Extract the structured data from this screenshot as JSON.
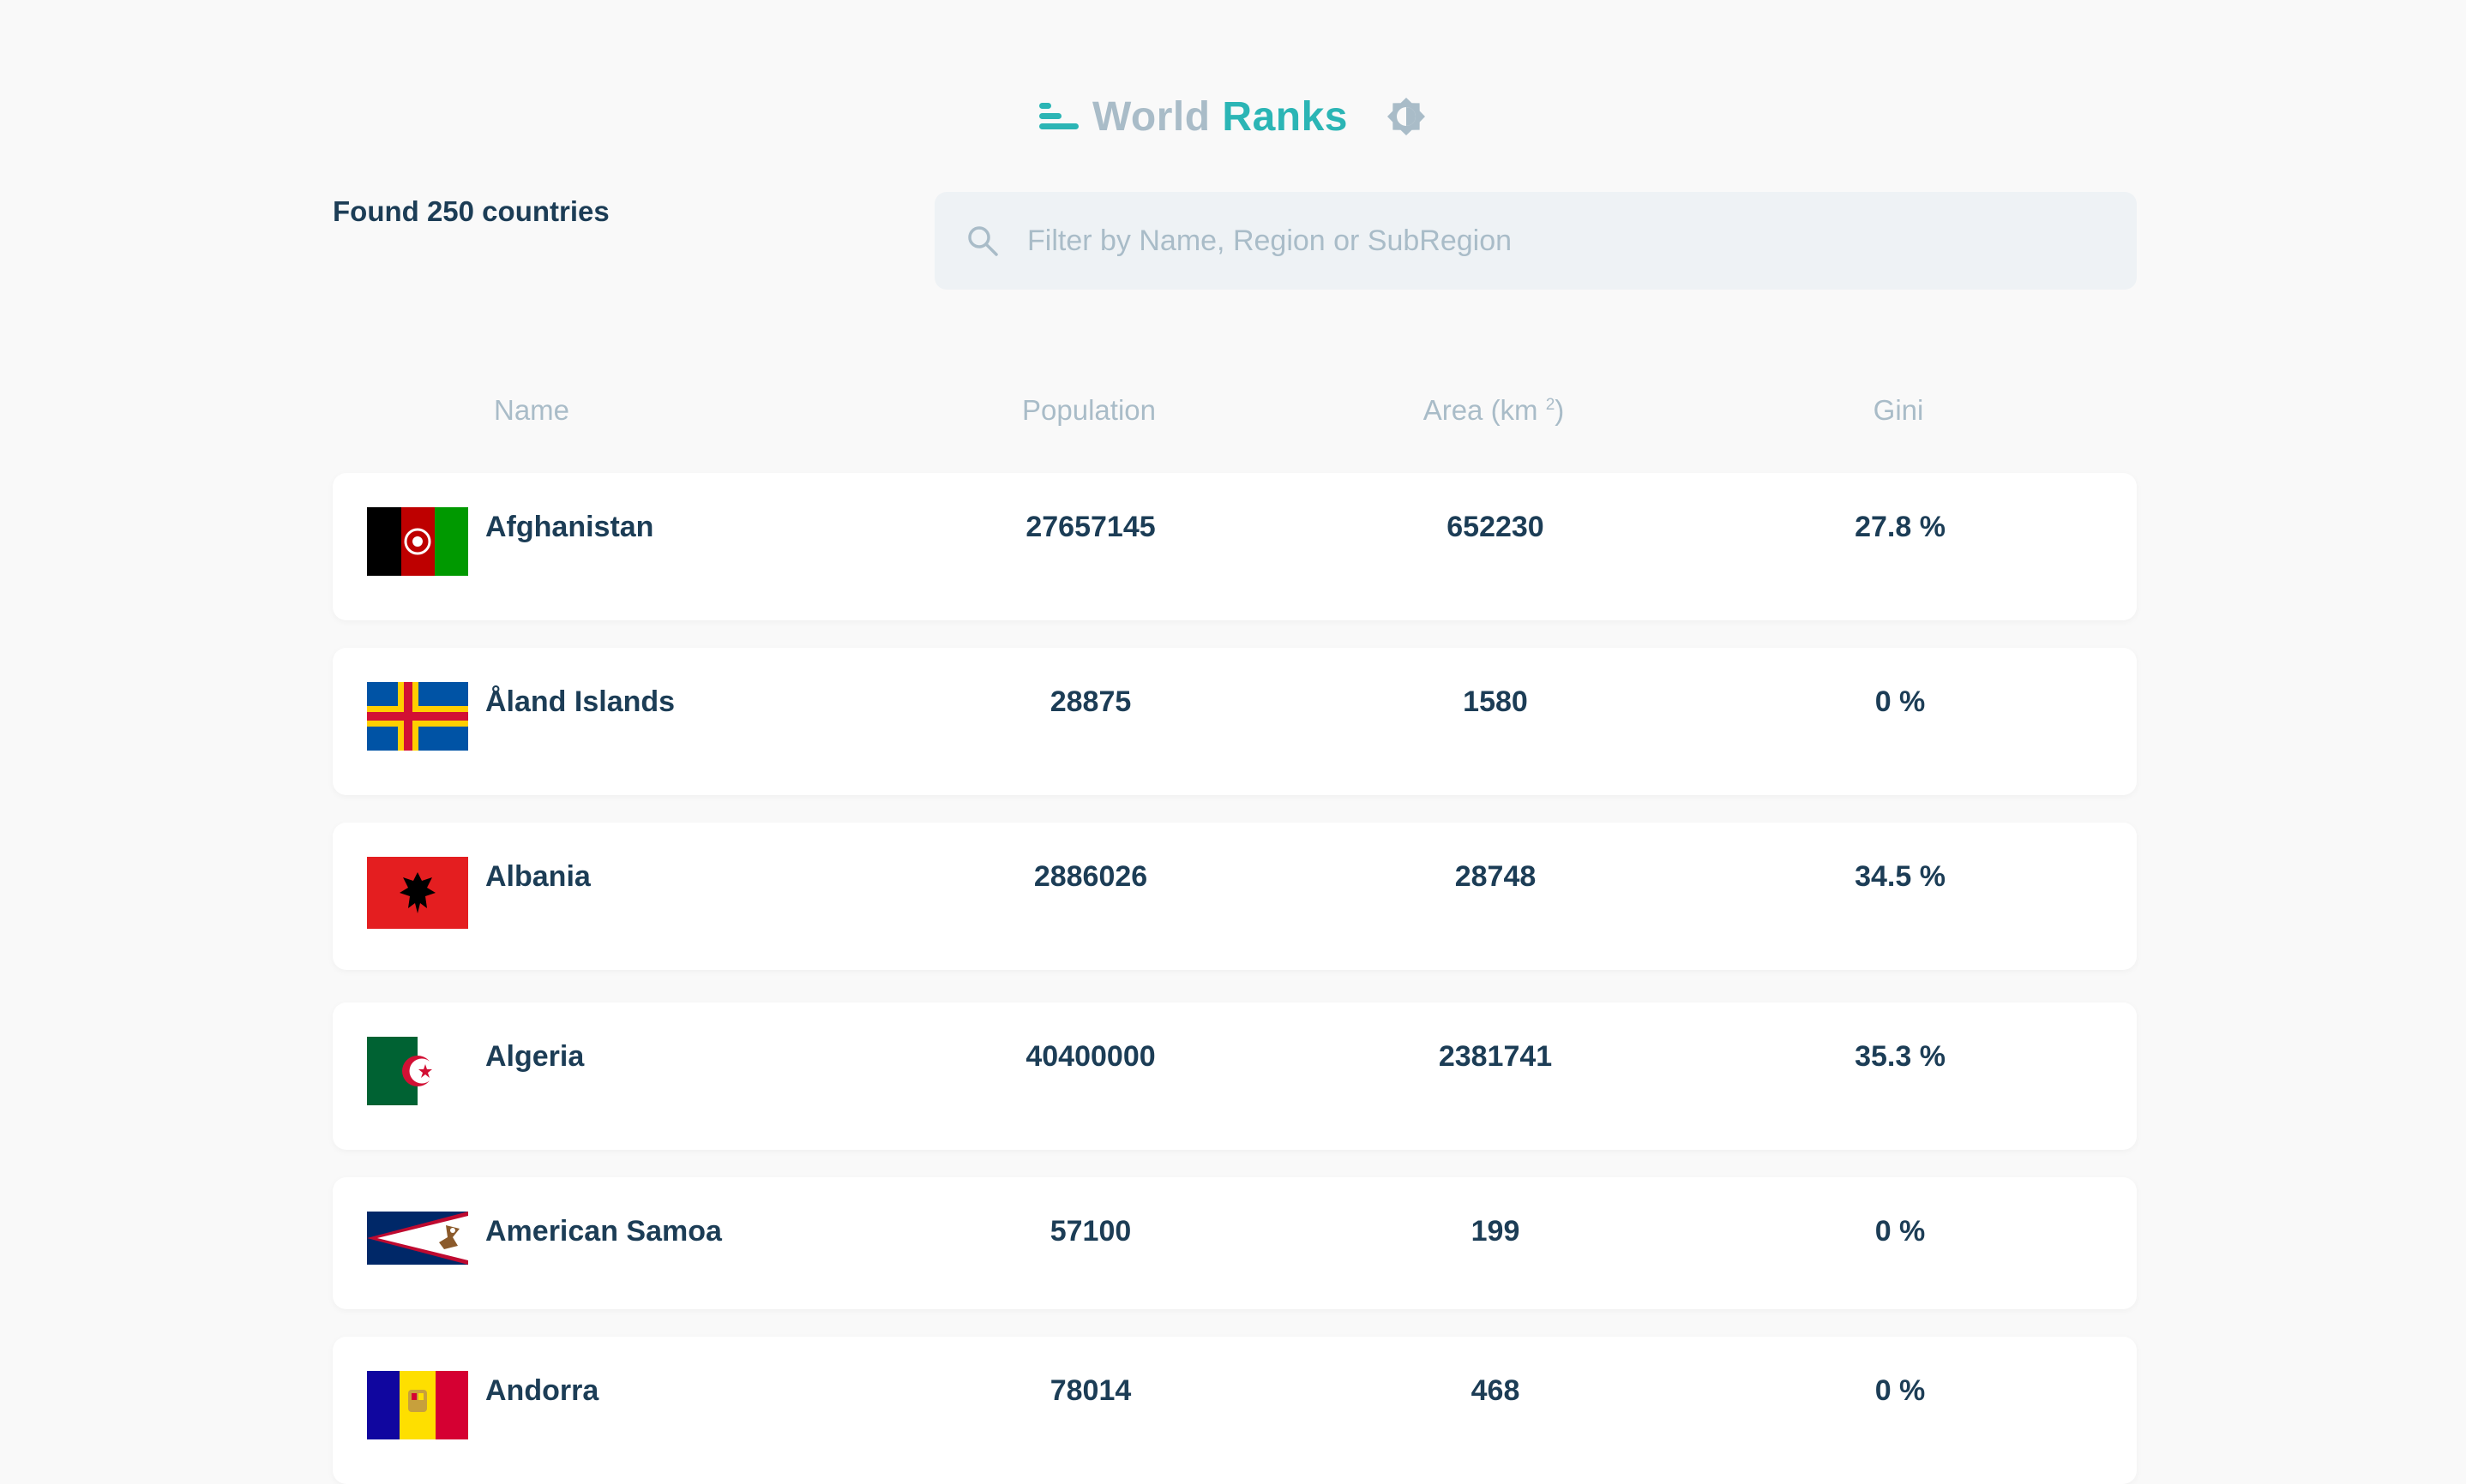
{
  "header": {
    "title_part1": "World",
    "title_part2": "Ranks",
    "icons": {
      "logo": "bar-chart-icon",
      "theme": "brightness-icon"
    },
    "colors": {
      "accent": "#2bb5b5",
      "muted": "#a9bcc8",
      "text": "#1c3d56"
    }
  },
  "summary": {
    "found_text": "Found 250 countries"
  },
  "search": {
    "placeholder": "Filter by Name, Region or SubRegion",
    "value": ""
  },
  "table": {
    "columns": {
      "name": "Name",
      "population": "Population",
      "area": "Area (km",
      "area_sup": "2",
      "area_close": ")",
      "gini": "Gini"
    },
    "rows": [
      {
        "name": "Afghanistan",
        "population": "27657145",
        "area": "652230",
        "gini": "27.8 %",
        "flag": "afghanistan-flag-icon"
      },
      {
        "name": "Åland Islands",
        "population": "28875",
        "area": "1580",
        "gini": "0 %",
        "flag": "aland-islands-flag-icon"
      },
      {
        "name": "Albania",
        "population": "2886026",
        "area": "28748",
        "gini": "34.5 %",
        "flag": "albania-flag-icon"
      },
      {
        "name": "Algeria",
        "population": "40400000",
        "area": "2381741",
        "gini": "35.3 %",
        "flag": "algeria-flag-icon"
      },
      {
        "name": "American Samoa",
        "population": "57100",
        "area": "199",
        "gini": "0 %",
        "flag": "american-samoa-flag-icon"
      },
      {
        "name": "Andorra",
        "population": "78014",
        "area": "468",
        "gini": "0 %",
        "flag": "andorra-flag-icon"
      }
    ]
  }
}
